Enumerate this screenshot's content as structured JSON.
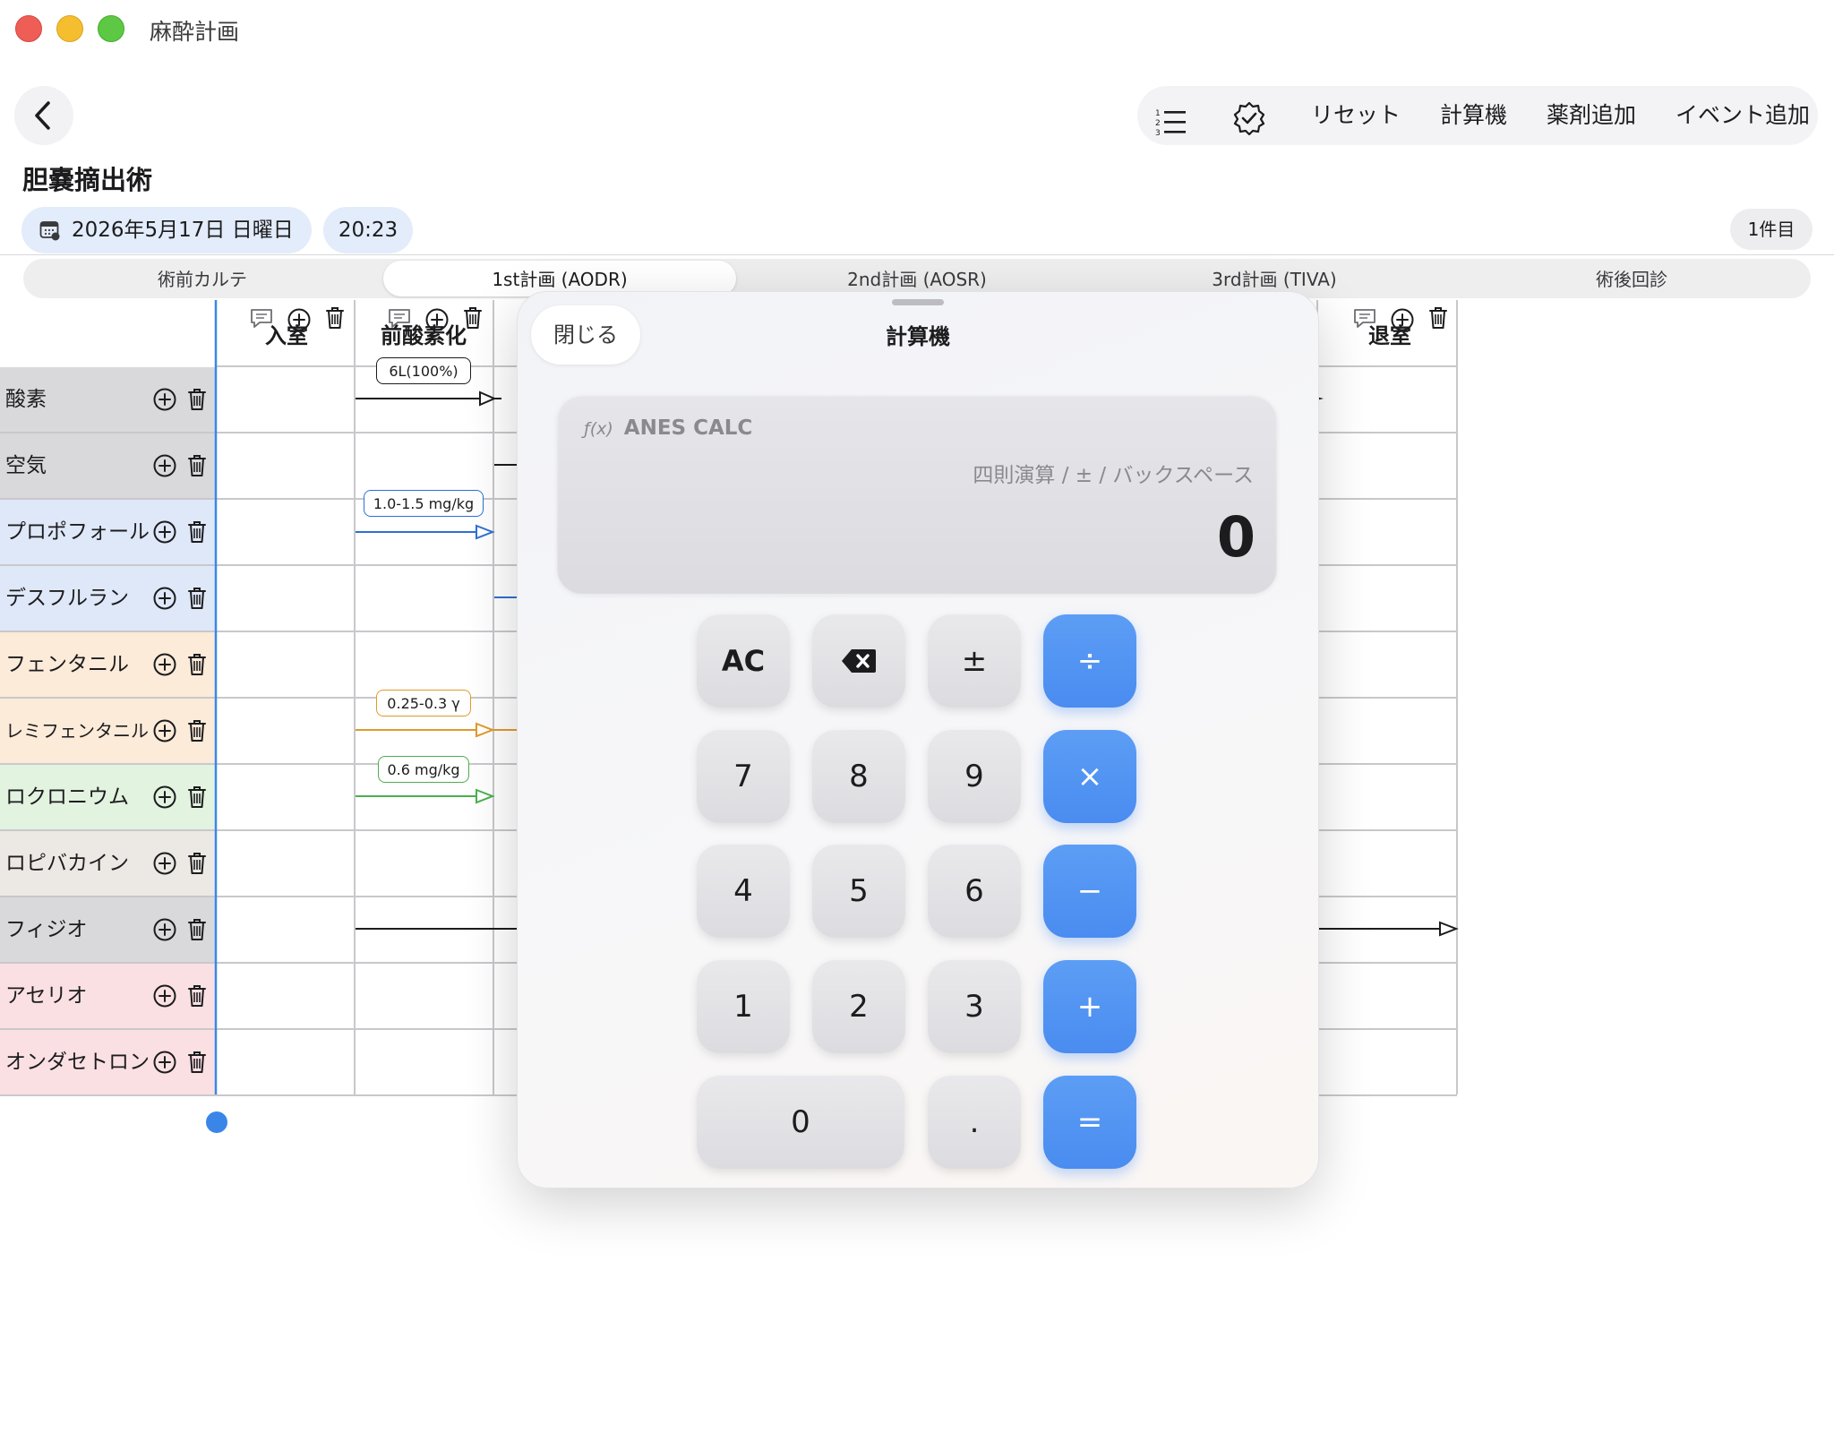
{
  "window": {
    "title": "麻酔計画"
  },
  "toolbar": {
    "reset": "リセット",
    "calculator": "計算機",
    "add_drug": "薬剤追加",
    "add_event": "イベント追加",
    "icons": [
      "numbered-list-icon",
      "checkmark-seal-icon"
    ]
  },
  "page": {
    "title": "胆嚢摘出術",
    "date": "2026年5月17日 日曜日",
    "time": "20:23",
    "count": "1件目"
  },
  "tabs": [
    "術前カルテ",
    "1st計画 (AODR)",
    "2nd計画 (AOSR)",
    "3rd計画 (TIVA)",
    "術後回診"
  ],
  "active_tab": "1st計画 (AODR)",
  "columns": [
    "入室",
    "前酸素化",
    "退室"
  ],
  "rows": [
    {
      "label": "酸素",
      "color": "#d9d9db"
    },
    {
      "label": "空気",
      "color": "#d9d9db"
    },
    {
      "label": "プロポフォール",
      "color": "#dfe8f8"
    },
    {
      "label": "デスフルラン",
      "color": "#dfe8f8"
    },
    {
      "label": "フェンタニル",
      "color": "#fcebd9"
    },
    {
      "label": "レミフェンタニル",
      "color": "#fcebd9"
    },
    {
      "label": "ロクロニウム",
      "color": "#e2f3e0"
    },
    {
      "label": "ロピバカイン",
      "color": "#ece9e4"
    },
    {
      "label": "フィジオ",
      "color": "#d9d9db"
    },
    {
      "label": "アセリオ",
      "color": "#fbe0e3"
    },
    {
      "label": "オンダセトロン",
      "color": "#fbe0e3"
    }
  ],
  "doses": [
    {
      "text": "6L(100%)",
      "color": "#1c1c1e"
    },
    {
      "text": "1.0-1.5 mg/kg",
      "color": "#2f6fd4"
    },
    {
      "text": "0.25-0.3 γ",
      "color": "#e09a2a"
    },
    {
      "text": "0.6 mg/kg",
      "color": "#4caf50"
    }
  ],
  "calculator": {
    "close": "閉じる",
    "title": "計算機",
    "brand": "ANES CALC",
    "fx": "ƒ(x)",
    "hint": "四則演算 / ± / バックスペース",
    "value": "0",
    "keys": {
      "ac": "AC",
      "plusminus": "±",
      "divide": "÷",
      "multiply": "×",
      "minus": "−",
      "plus": "+",
      "equals": "=",
      "k7": "7",
      "k8": "8",
      "k9": "9",
      "k4": "4",
      "k5": "5",
      "k6": "6",
      "k1": "1",
      "k2": "2",
      "k3": "3",
      "k0": "0",
      "dot": "."
    },
    "accent": "#4a8cf0"
  }
}
